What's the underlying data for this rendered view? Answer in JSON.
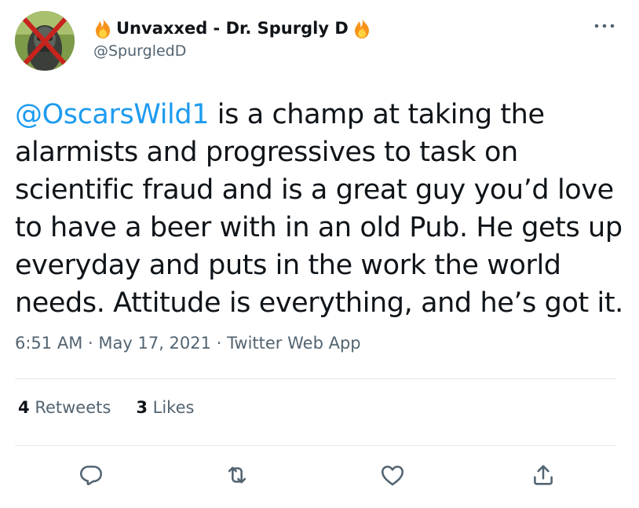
{
  "author": {
    "display_name": "Unvaxxed - Dr. Spurgly D",
    "handle": "@SpurgledD",
    "avatar_icon": "crossed-out-mask-avatar",
    "name_prefix_icon": "fire-icon",
    "name_suffix_icon": "fire-icon"
  },
  "tweet": {
    "mention": "@OscarsWild1",
    "line1_rest": " is a champ at taking the",
    "line2": "alarmists and progressives to task on",
    "line3": "scientific fraud and is a great guy you’d love",
    "line4": "to have a beer with in an old Pub. He gets up",
    "line5": "everyday and puts in the work the world",
    "line6": "needs. Attitude is everything, and he’s got it."
  },
  "meta": {
    "time": "6:51 AM",
    "separator": "·",
    "date": "May 17, 2021",
    "source": "Twitter Web App"
  },
  "stats": {
    "retweets_count": "4",
    "retweets_label": "Retweets",
    "likes_count": "3",
    "likes_label": "Likes"
  },
  "actions": {
    "reply_icon": "reply-icon",
    "retweet_icon": "retweet-icon",
    "like_icon": "heart-icon",
    "share_icon": "share-icon"
  },
  "colors": {
    "accent": "#1d9bf0",
    "text": "#0f1419",
    "secondary": "#536471",
    "divider": "#e3e8ec",
    "fire": "#f7931a"
  }
}
